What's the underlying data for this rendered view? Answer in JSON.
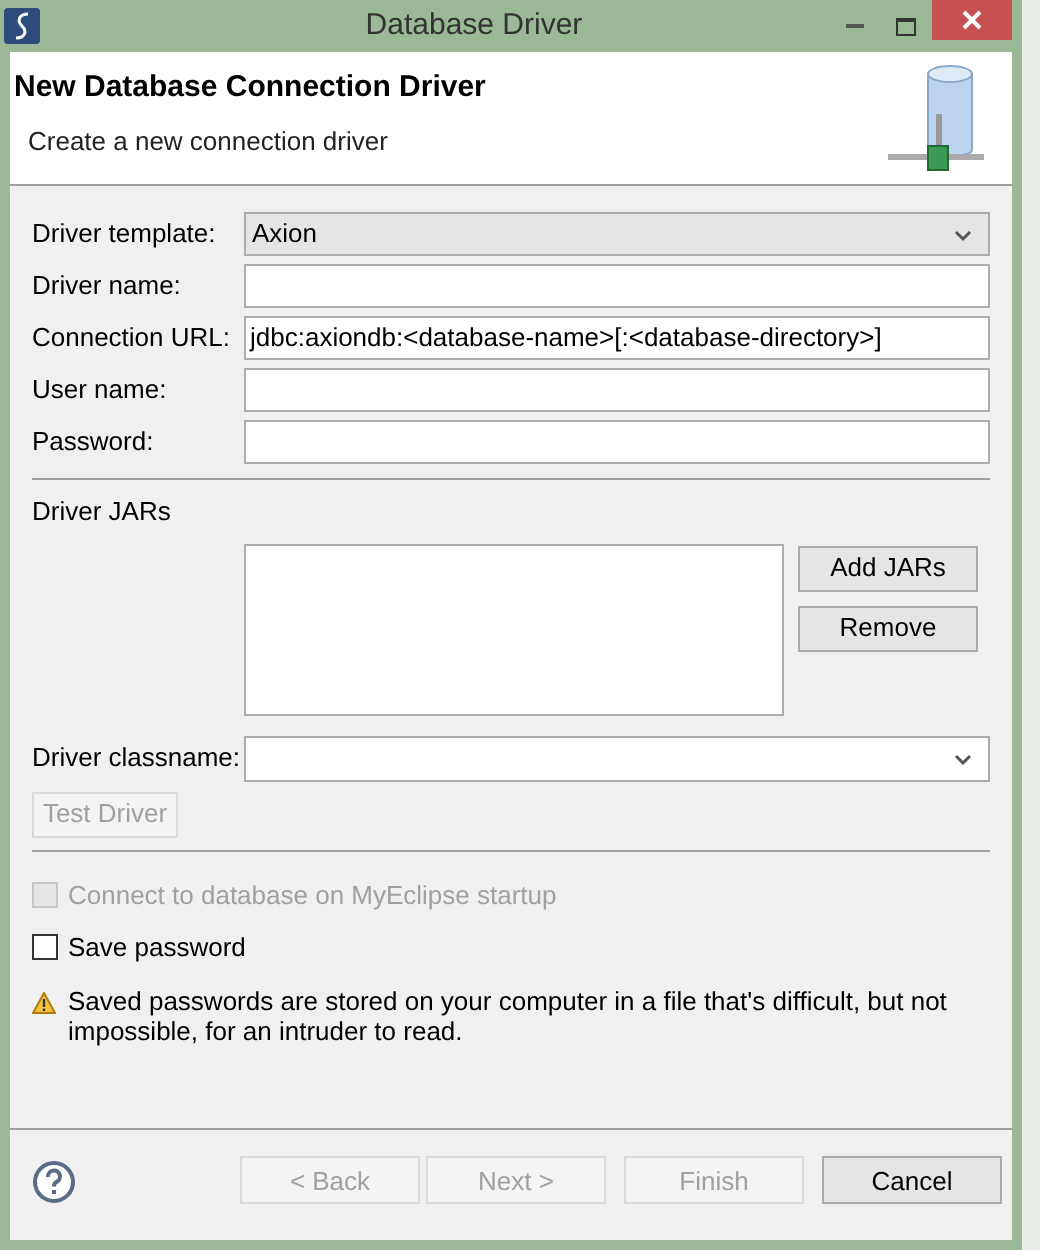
{
  "window": {
    "title": "Database Driver"
  },
  "header": {
    "title": "New Database Connection Driver",
    "subtitle": "Create a new connection driver"
  },
  "fields": [
    {
      "kind": "dropdown",
      "label": "Driver template:",
      "value": "Axion"
    },
    {
      "kind": "text",
      "label": "Driver name:"
    },
    {
      "kind": "text",
      "label": "Connection URL:",
      "value": "jdbc:axiondb:<database-name>[:<database-directory>]"
    },
    {
      "kind": "text",
      "label": "User name:"
    },
    {
      "kind": "text",
      "label": "Password:"
    }
  ],
  "jars": {
    "label": "Driver JARs",
    "buttons": [
      {
        "label": "Add JARs",
        "disabled": false
      },
      {
        "label": "Remove",
        "disabled": false
      }
    ]
  },
  "classname": {
    "label": "Driver classname:"
  },
  "test_button": {
    "label": "Test Driver",
    "disabled": true
  },
  "checkboxes": [
    {
      "label": "Connect to database on MyEclipse startup",
      "checked": false,
      "disabled": true
    },
    {
      "label": "Save password",
      "checked": false,
      "disabled": false
    }
  ],
  "warning": "Saved passwords are stored on your computer in a file that's difficult, but not impossible, for an intruder to read.",
  "footer_buttons": [
    {
      "label": "< Back",
      "disabled": true
    },
    {
      "label": "Next >",
      "disabled": true
    },
    {
      "label": "Finish",
      "disabled": true
    },
    {
      "label": "Cancel",
      "disabled": false
    }
  ]
}
